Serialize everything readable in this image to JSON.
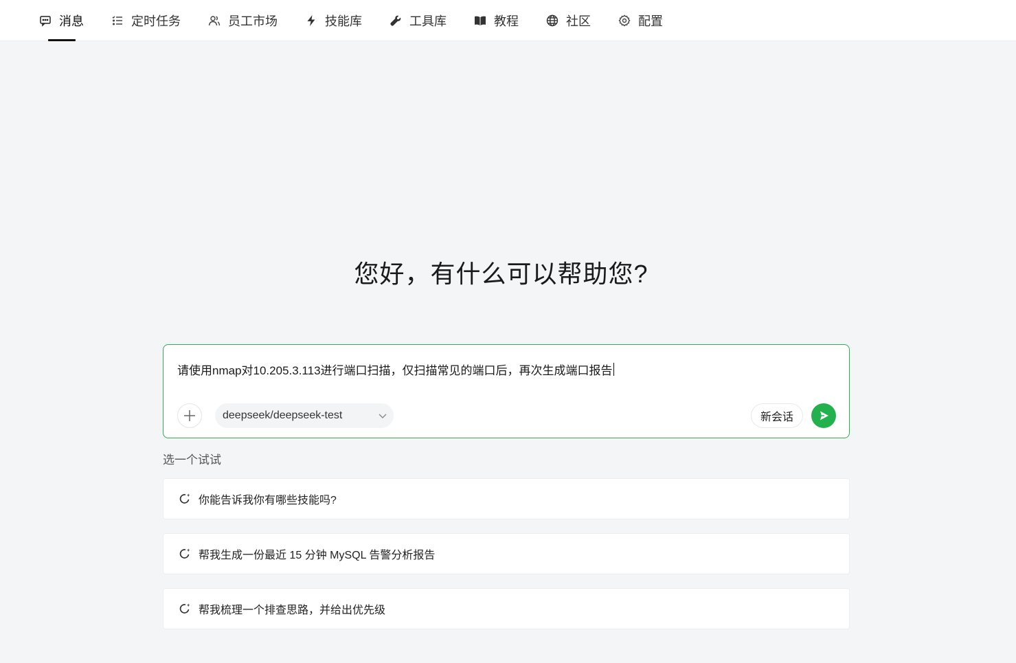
{
  "nav": {
    "items": [
      {
        "label": "消息",
        "icon": "message-icon",
        "active": true
      },
      {
        "label": "定时任务",
        "icon": "list-icon",
        "active": false
      },
      {
        "label": "员工市场",
        "icon": "users-icon",
        "active": false
      },
      {
        "label": "技能库",
        "icon": "lightning-icon",
        "active": false
      },
      {
        "label": "工具库",
        "icon": "wrench-icon",
        "active": false
      },
      {
        "label": "教程",
        "icon": "book-icon",
        "active": false
      },
      {
        "label": "社区",
        "icon": "globe-icon",
        "active": false
      },
      {
        "label": "配置",
        "icon": "gear-icon",
        "active": false
      }
    ]
  },
  "greeting": "您好，有什么可以帮助您?",
  "composer": {
    "value": "请使用nmap对10.205.3.113进行端口扫描，仅扫描常见的端口后，再次生成端口报告",
    "model": "deepseek/deepseek-test",
    "new_session_label": "新会话"
  },
  "suggestions": {
    "title": "选一个试试",
    "items": [
      {
        "label": "你能告诉我你有哪些技能吗?"
      },
      {
        "label": "帮我生成一份最近 15 分钟 MySQL 告警分析报告"
      },
      {
        "label": "帮我梳理一个排查思路，并给出优先级"
      }
    ]
  },
  "colors": {
    "accent": "#22b14c",
    "border_focus": "#2bb34d",
    "background": "#f4f5f7"
  }
}
